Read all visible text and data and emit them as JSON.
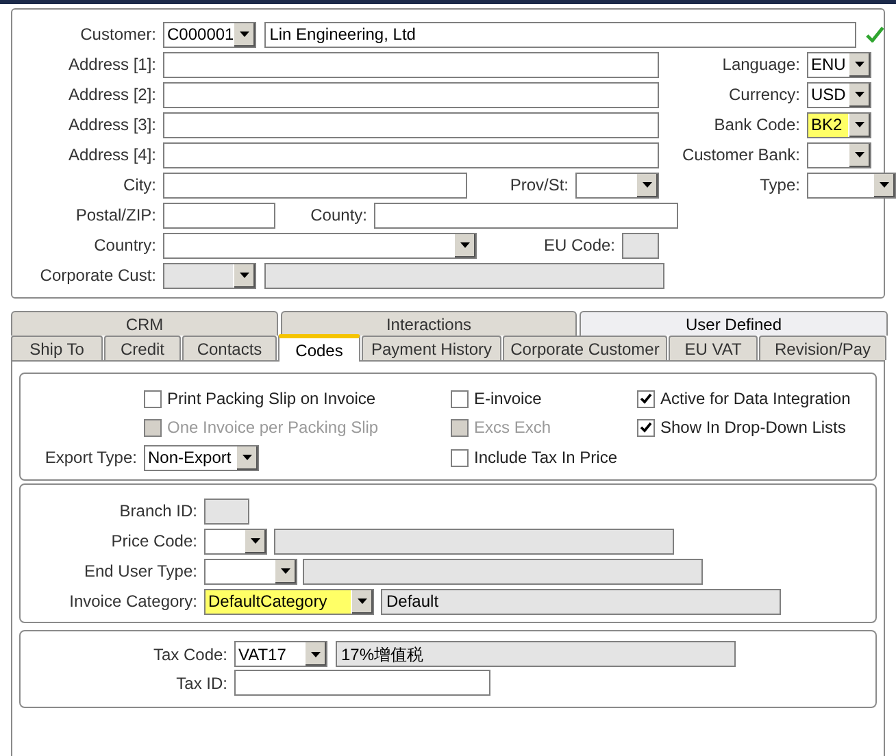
{
  "header": {
    "customer": {
      "label": "Customer:",
      "code": "C000001",
      "name": "Lin Engineering, Ltd",
      "valid": true
    },
    "address": [
      {
        "label": "Address [1]:"
      },
      {
        "label": "Address [2]:"
      },
      {
        "label": "Address [3]:"
      },
      {
        "label": "Address [4]:"
      }
    ],
    "right_fields": [
      {
        "label": "Language:",
        "value": "ENU",
        "highlighted": false
      },
      {
        "label": "Currency:",
        "value": "USD",
        "highlighted": false
      },
      {
        "label": "Bank Code:",
        "value": "BK2",
        "highlighted": true
      },
      {
        "label": "Customer Bank:",
        "highlighted": false
      }
    ],
    "city": {
      "label": "City:"
    },
    "prov": {
      "label": "Prov/St:"
    },
    "type": {
      "label": "Type:"
    },
    "postal": {
      "label": "Postal/ZIP:"
    },
    "county": {
      "label": "County:"
    },
    "country": {
      "label": "Country:"
    },
    "eu_code": {
      "label": "EU Code:",
      "disabled": true
    },
    "corporate": {
      "label": "Corporate Cust:",
      "disabled": true
    }
  },
  "tabs_top": [
    {
      "label": "CRM",
      "highlighted": false
    },
    {
      "label": "Interactions",
      "highlighted": false
    },
    {
      "label": "User Defined",
      "highlighted": true
    }
  ],
  "tabs": [
    {
      "label": "Ship To",
      "selected": false
    },
    {
      "label": "Credit",
      "selected": false
    },
    {
      "label": "Contacts",
      "selected": false
    },
    {
      "label": "Codes",
      "selected": true
    },
    {
      "label": "Payment History",
      "selected": false
    },
    {
      "label": "Corporate Customer",
      "selected": false
    },
    {
      "label": "EU VAT",
      "selected": false
    },
    {
      "label": "Revision/Pay",
      "selected": false
    }
  ],
  "options": {
    "checkboxes": [
      {
        "label": "Print Packing Slip on Invoice",
        "checked": false,
        "disabled": false
      },
      {
        "label": "E-invoice",
        "checked": false,
        "disabled": false
      },
      {
        "label": "Active for Data Integration",
        "checked": true,
        "disabled": false
      },
      {
        "label": "One Invoice per Packing Slip",
        "checked": false,
        "disabled": true
      },
      {
        "label": "Excs Exch",
        "checked": false,
        "disabled": true
      },
      {
        "label": "Show In Drop-Down Lists",
        "checked": true,
        "disabled": false
      },
      {
        "label": "Include Tax In Price",
        "checked": false,
        "disabled": false
      }
    ],
    "export_type": {
      "label": "Export Type:",
      "value": "Non-Export"
    }
  },
  "pricing": {
    "branch_id": {
      "label": "Branch ID:",
      "disabled": true
    },
    "price_code": {
      "label": "Price Code:"
    },
    "end_user_type": {
      "label": "End User Type:"
    },
    "invoice_category": {
      "label": "Invoice Category:",
      "value": "DefaultCategory",
      "description": "Default",
      "highlighted": true
    }
  },
  "tax": {
    "tax_code": {
      "label": "Tax Code:",
      "value": "VAT17",
      "description": "17%增值税"
    },
    "tax_id": {
      "label": "Tax ID:"
    }
  }
}
